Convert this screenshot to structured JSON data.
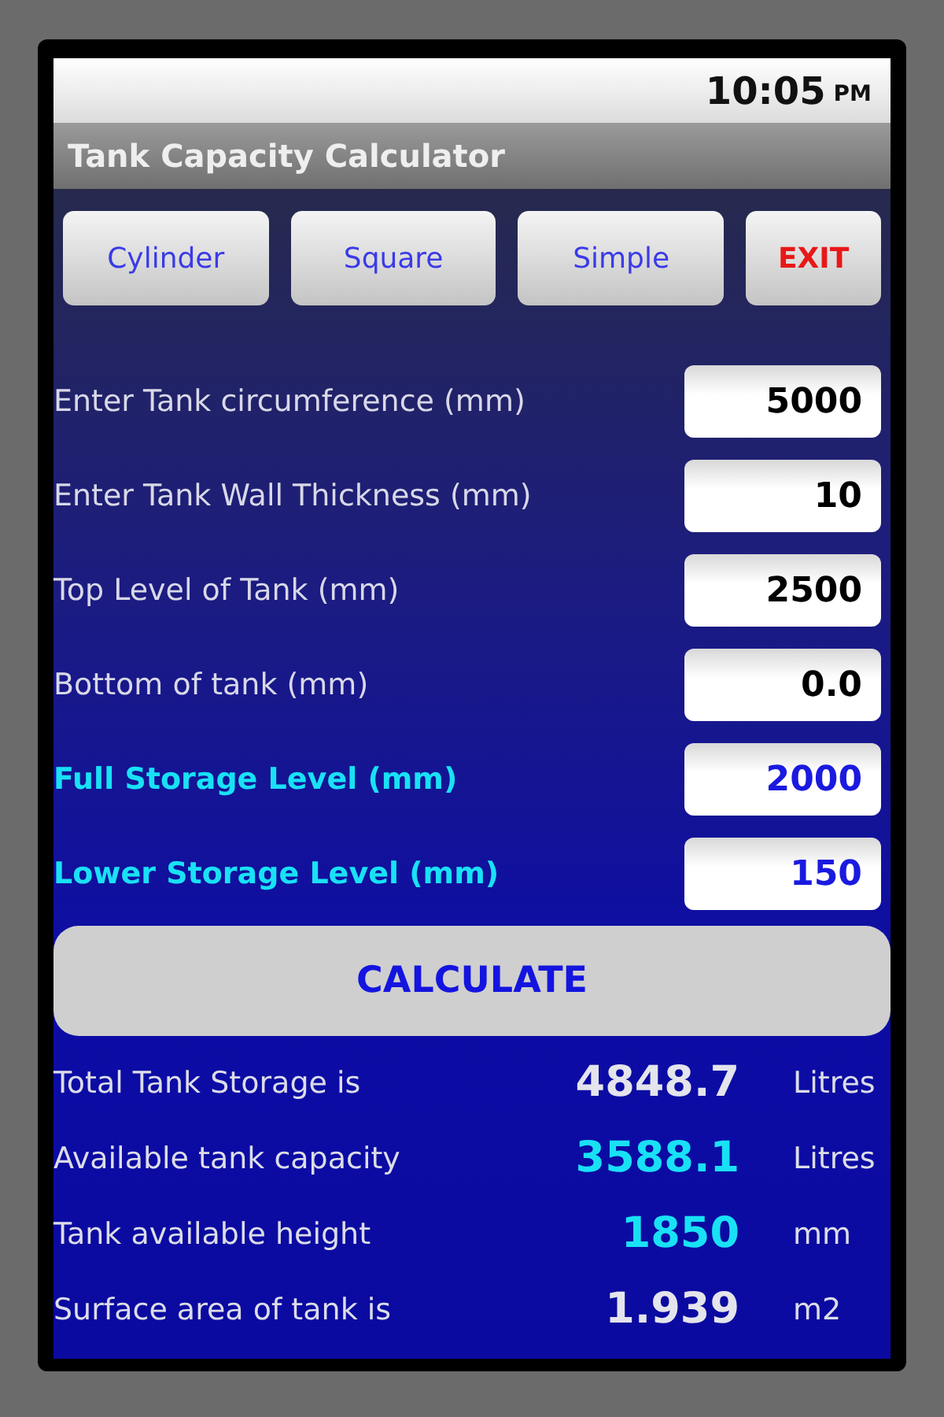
{
  "status_bar": {
    "time": "10:05",
    "period": "PM"
  },
  "app_title": "Tank Capacity Calculator",
  "mode_buttons": [
    {
      "label": "Cylinder",
      "kind": "mode"
    },
    {
      "label": "Square",
      "kind": "mode"
    },
    {
      "label": "Simple",
      "kind": "mode"
    },
    {
      "label": "EXIT",
      "kind": "exit"
    }
  ],
  "fields": [
    {
      "label": "Enter Tank circumference (mm)",
      "value": "5000",
      "kind": "plain"
    },
    {
      "label": "Enter Tank Wall Thickness (mm)",
      "value": "10",
      "kind": "plain"
    },
    {
      "label": "Top Level of Tank (mm)",
      "value": "2500",
      "kind": "plain"
    },
    {
      "label": "Bottom of tank (mm)",
      "value": "0.0",
      "kind": "plain"
    },
    {
      "label": "Full Storage Level (mm)",
      "value": "2000",
      "kind": "storage"
    },
    {
      "label": "Lower Storage Level (mm)",
      "value": "150",
      "kind": "storage"
    }
  ],
  "calculate_button": "CALCULATE",
  "results": [
    {
      "label": "Total Tank Storage is",
      "value": "4848.7",
      "unit": "Litres",
      "kind": "plain"
    },
    {
      "label": "Available tank capacity",
      "value": "3588.1",
      "unit": "Litres",
      "kind": "storage"
    },
    {
      "label": "Tank available height",
      "value": "1850",
      "unit": "mm",
      "kind": "storage"
    },
    {
      "label": "Surface area of tank is",
      "value": "1.939",
      "unit": "m2",
      "kind": "plain"
    }
  ]
}
